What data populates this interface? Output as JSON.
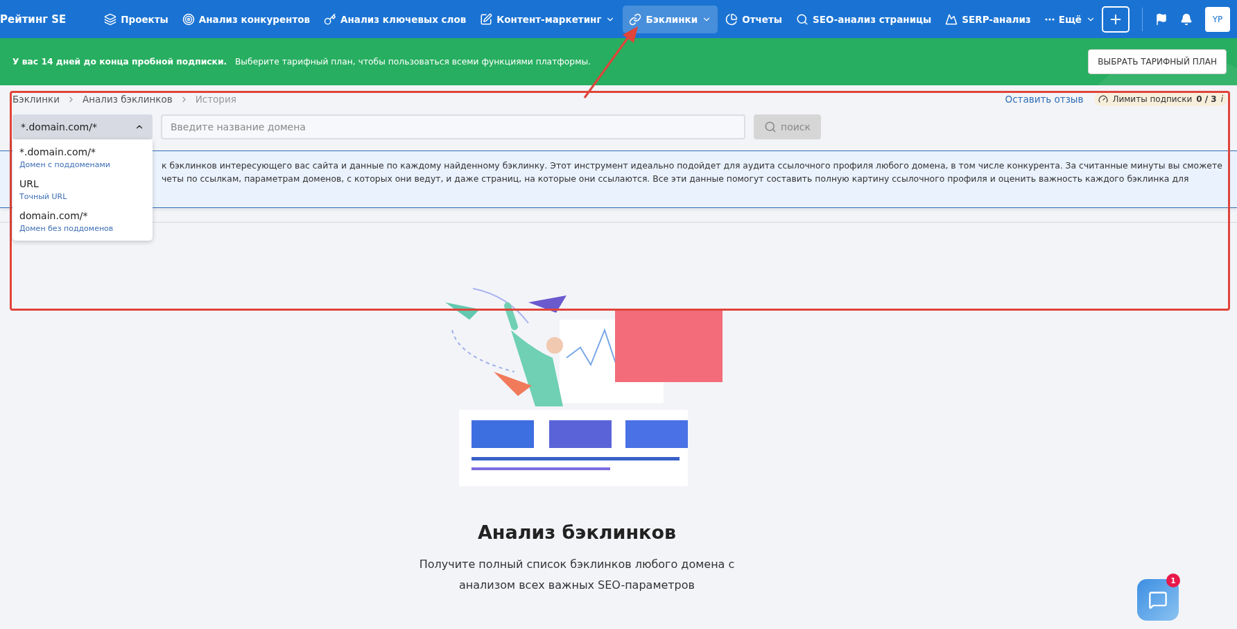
{
  "nav": {
    "logo": "Рейтинг SE",
    "items": [
      {
        "label": "Проекты",
        "has_menu": false,
        "selected": false
      },
      {
        "label": "Анализ конкурентов",
        "has_menu": false,
        "selected": false
      },
      {
        "label": "Анализ ключевых слов",
        "has_menu": false,
        "selected": false
      },
      {
        "label": "Контент-маркетинг",
        "has_menu": true,
        "selected": false
      },
      {
        "label": "Бэклинки",
        "has_menu": true,
        "selected": true
      },
      {
        "label": "Отчеты",
        "has_menu": false,
        "selected": false
      },
      {
        "label": "SEO-анализ страницы",
        "has_menu": false,
        "selected": false
      },
      {
        "label": "SERP-анализ",
        "has_menu": false,
        "selected": false
      },
      {
        "label": "Ещё",
        "has_menu": true,
        "selected": false
      }
    ],
    "avatar": "YP"
  },
  "trial_banner": {
    "lead": "У вас 14 дней до конца пробной подписки.",
    "text": "Выберите тарифный план, чтобы пользоваться всеми функциями платформы.",
    "button": "ВЫБРАТЬ ТАРИФНЫЙ ПЛАН"
  },
  "breadcrumbs": [
    "Бэклинки",
    "Анализ бэклинков",
    "История"
  ],
  "feedback_link": "Оставить отзыв",
  "limits": {
    "label": "Лимиты подписки",
    "value": "0 / 3",
    "info": "i"
  },
  "scope_select": {
    "value": "*.domain.com/*",
    "expanded": true,
    "options": [
      {
        "label": "*.domain.com/*",
        "hint": "Домен с поддоменами"
      },
      {
        "label": "URL",
        "hint": "Точный URL"
      },
      {
        "label": "domain.com/*",
        "hint": "Домен без поддоменов"
      }
    ]
  },
  "domain_input": {
    "placeholder": "Введите название домена"
  },
  "search_button": {
    "label": "поиск",
    "disabled": true
  },
  "info_notice": {
    "lines": [
      "к бэклинков интересующего вас сайта и данные по каждому найденному бэклинку. Этот инструмент идеально подойдет для аудита ссылочного профиля любого домена, в том числе конкурента. За считанные минуты вы сможете",
      "четы по ссылкам, параметрам доменов, с которых они ведут, и даже страниц, на которые они ссылаются. Все эти данные помогут составить полную картину ссылочного профиля и оценить важность каждого бэклинка для"
    ]
  },
  "empty_state": {
    "title": "Анализ бэклинков",
    "subtitle": "Получите полный список бэклинков любого домена с анализом всех важных SEO-параметров"
  },
  "chat": {
    "badge": "1"
  }
}
